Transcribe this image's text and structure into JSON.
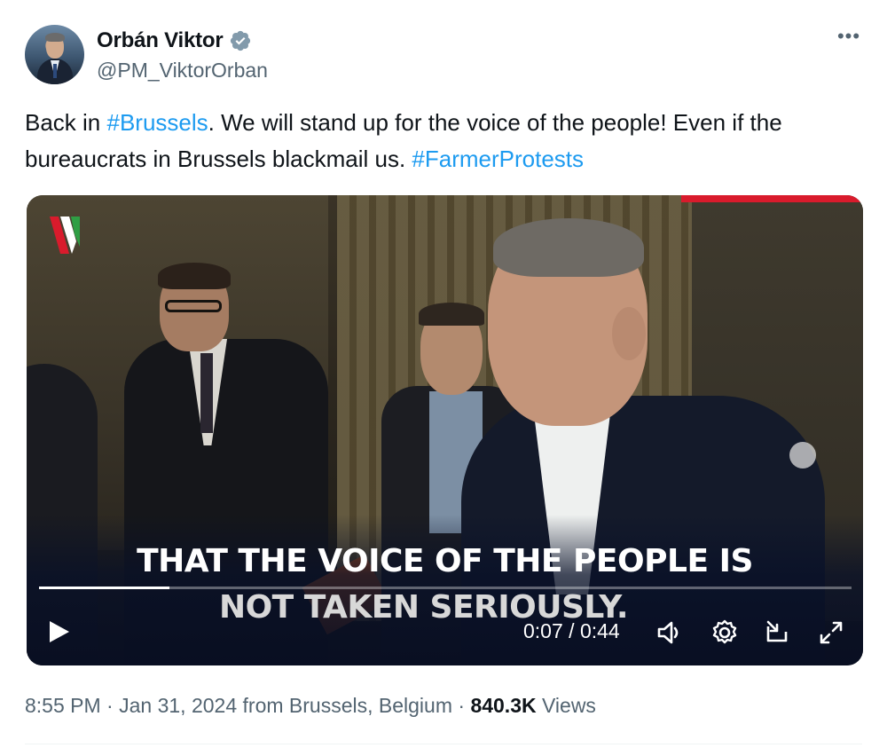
{
  "author": {
    "display_name": "Orbán Viktor",
    "handle": "@PM_ViktorOrban",
    "verified": true
  },
  "icons": {
    "verified": "verified-badge-icon",
    "more": "more-horizontal-icon",
    "play": "play-icon",
    "volume": "volume-icon",
    "settings": "settings-gear-icon",
    "pip": "picture-in-picture-icon",
    "fullscreen": "fullscreen-icon"
  },
  "tweet": {
    "text_part1": "Back in ",
    "hashtag1": "#Brussels",
    "text_part2": ". We will stand up for the voice of the people! Even if the bureaucrats in Brussels blackmail us. ",
    "hashtag2": "#FarmerProtests"
  },
  "video": {
    "caption_line1": "THAT THE VOICE OF THE PEOPLE IS",
    "caption_line2": "NOT TAKEN SERIOUSLY.",
    "current_time": "0:07",
    "separator": " / ",
    "duration": "0:44",
    "progress": 0.16
  },
  "meta": {
    "time": "8:55 PM",
    "dot1": " · ",
    "date": "Jan 31, 2024",
    "location": " from Brussels, Belgium",
    "dot2": " · ",
    "views_count": "840.3K",
    "views_label": " Views"
  },
  "colors": {
    "accent": "#1d9bf0",
    "text_primary": "#0f1419",
    "text_secondary": "#536471",
    "brand_red": "#d91b2c"
  }
}
